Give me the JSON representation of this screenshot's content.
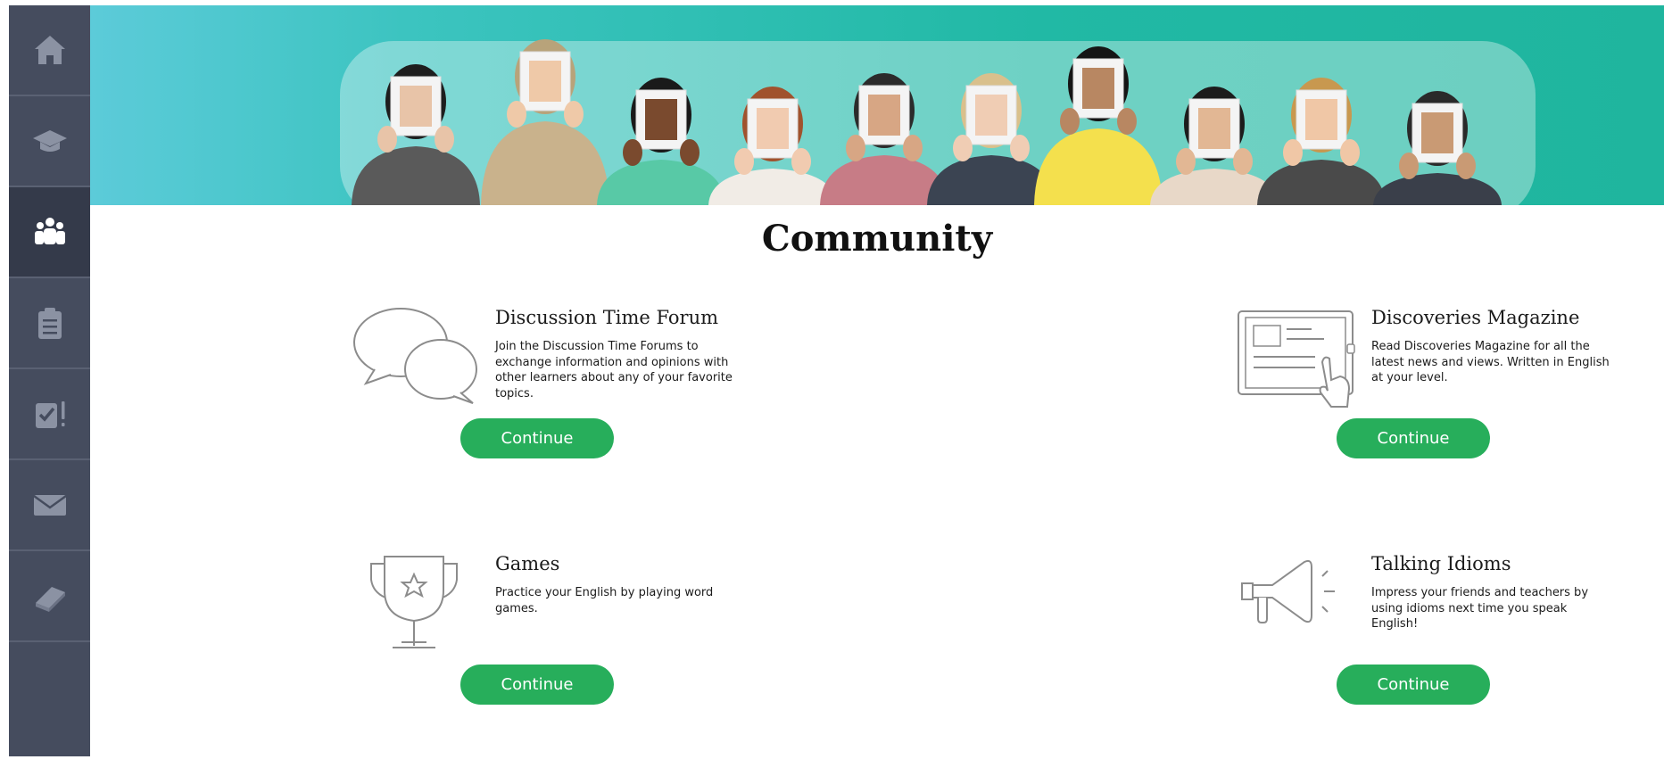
{
  "sidebar": {
    "items": [
      {
        "icon": "home-icon",
        "active": false
      },
      {
        "icon": "graduation-cap-icon",
        "active": false
      },
      {
        "icon": "community-group-icon",
        "active": true
      },
      {
        "icon": "clipboard-list-icon",
        "active": false
      },
      {
        "icon": "assignment-check-icon",
        "active": false
      },
      {
        "icon": "mail-icon",
        "active": false
      },
      {
        "icon": "book-icon",
        "active": false
      }
    ]
  },
  "banner": {
    "colors": {
      "left": "#5ccbd9",
      "right": "#1fb59e"
    }
  },
  "page": {
    "title": "Community"
  },
  "cards": [
    {
      "icon": "speech-bubbles-icon",
      "title": "Discussion Time Forum",
      "description": "Join the Discussion Time Forums to exchange information and opinions with other learners about any of your favorite topics.",
      "button": "Continue"
    },
    {
      "icon": "tablet-magazine-icon",
      "title": "Discoveries Magazine",
      "description": "Read Discoveries Magazine for all the latest news and views. Written in English at your level.",
      "button": "Continue"
    },
    {
      "icon": "trophy-icon",
      "title": "Games",
      "description": "Practice your English by playing word games.",
      "button": "Continue"
    },
    {
      "icon": "megaphone-icon",
      "title": "Talking Idioms",
      "description": "Impress your friends and teachers by using idioms next time you speak English!",
      "button": "Continue"
    }
  ],
  "colors": {
    "accent": "#27ae5b",
    "sidebar": "#454c5e",
    "sidebar_active": "#343a4a"
  }
}
